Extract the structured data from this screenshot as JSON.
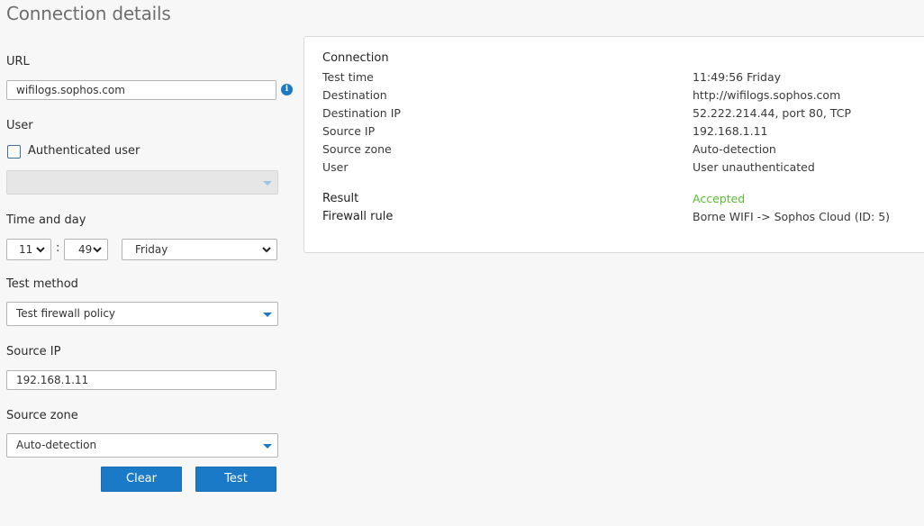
{
  "page": {
    "title": "Connection details"
  },
  "form": {
    "url": {
      "label": "URL",
      "value": "wifilogs.sophos.com",
      "info_icon": "info-icon"
    },
    "user": {
      "label": "User",
      "checkbox_label": "Authenticated user",
      "checked": false,
      "select_value": ""
    },
    "time": {
      "label": "Time and day",
      "hour": "11",
      "separator": ":",
      "minute": "49",
      "day": "Friday"
    },
    "test_method": {
      "label": "Test method",
      "value": "Test firewall policy"
    },
    "source_ip": {
      "label": "Source IP",
      "value": "192.168.1.11"
    },
    "source_zone": {
      "label": "Source zone",
      "value": "Auto-detection"
    },
    "buttons": {
      "clear": "Clear",
      "test": "Test"
    },
    "accent_color": "#1a7ac8"
  },
  "results": {
    "connection_heading": "Connection",
    "rows": [
      {
        "key": "Test time",
        "value": "11:49:56 Friday"
      },
      {
        "key": "Destination",
        "value": "http://wifilogs.sophos.com"
      },
      {
        "key": "Destination IP",
        "value": "52.222.214.44, port 80, TCP"
      },
      {
        "key": "Source IP",
        "value": "192.168.1.11"
      },
      {
        "key": "Source zone",
        "value": "Auto-detection"
      },
      {
        "key": "User",
        "value": "User unauthenticated"
      }
    ],
    "result": {
      "key": "Result",
      "value": "Accepted",
      "color": "#5cbd34"
    },
    "firewall_rule": {
      "key": "Firewall rule",
      "value": "Borne WIFI -> Sophos Cloud (ID: 5)"
    }
  }
}
